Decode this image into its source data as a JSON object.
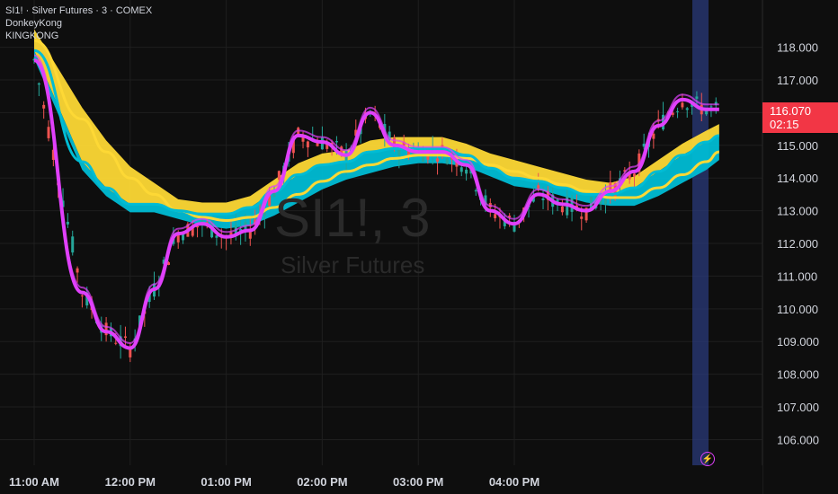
{
  "legend": {
    "title": "SI1! · Silver Futures · 3 · COMEX",
    "indicator_1": "DonkeyKong",
    "indicator_2": "KINGKONG"
  },
  "watermark": {
    "symbol": "SI1!, 3",
    "name": "Silver Futures"
  },
  "price_tag": {
    "price": "116.070",
    "countdown": "02:15"
  },
  "colors": {
    "background": "#0e0e0e",
    "grid": "#1f1f1f",
    "ribbon_yellow": "#fdd835",
    "ribbon_cyan": "#00bcd4",
    "fast_line": "#e040fb",
    "candle_up": "#26a69a",
    "candle_down": "#ef5350",
    "session_highlight": "#2a3a7a",
    "price_tag": "#f23645"
  },
  "icons": {
    "session_marker": "lightning-bolt-icon"
  },
  "chart_data": {
    "type": "line",
    "x_ticks": [
      "11:00 AM",
      "12:00 PM",
      "01:00 PM",
      "02:00 PM",
      "03:00 PM",
      "04:00 PM"
    ],
    "y_ticks": [
      "118.000",
      "117.000",
      "116.000",
      "115.000",
      "114.000",
      "113.000",
      "112.000",
      "111.000",
      "110.000",
      "109.000",
      "108.000",
      "107.000",
      "106.000"
    ],
    "ylim": [
      105.6,
      118.4
    ],
    "x_minutes": [
      0,
      30,
      45,
      60,
      75,
      90,
      105,
      120,
      135,
      150,
      165,
      180,
      195,
      210,
      225,
      240,
      255,
      270,
      285,
      300,
      315,
      330,
      345,
      360,
      375,
      390,
      405,
      420,
      428
    ],
    "series": [
      {
        "values": [
          117.6,
          110.5,
          109.3,
          108.8,
          110.6,
          112.3,
          112.6,
          112.2,
          112.4,
          113.6,
          115.3,
          115.1,
          114.7,
          116.0,
          115.0,
          114.8,
          114.8,
          114.4,
          113.0,
          112.6,
          113.5,
          113.2,
          113.0,
          113.6,
          114.2,
          115.6,
          116.4,
          116.1,
          116.1
        ]
      },
      {
        "values": [
          117.9,
          114.5,
          113.7,
          113.2,
          113.2,
          113.0,
          112.9,
          112.9,
          113.1,
          113.6,
          114.1,
          114.4,
          114.5,
          114.8,
          114.9,
          114.9,
          114.9,
          114.7,
          114.3,
          114.0,
          113.9,
          113.7,
          113.5,
          113.5,
          113.7,
          114.2,
          114.7,
          115.1,
          115.3
        ]
      },
      {
        "values": [
          118.2,
          115.8,
          114.8,
          114.0,
          113.5,
          113.0,
          112.8,
          112.7,
          112.8,
          113.1,
          113.5,
          113.9,
          114.2,
          114.4,
          114.6,
          114.7,
          114.7,
          114.6,
          114.4,
          114.2,
          114.0,
          113.8,
          113.6,
          113.4,
          113.4,
          113.7,
          114.1,
          114.5,
          114.8
        ]
      }
    ],
    "grid": true
  }
}
